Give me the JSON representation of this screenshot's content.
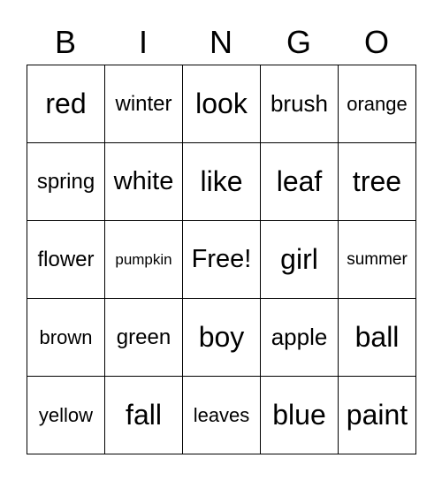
{
  "header": [
    "B",
    "I",
    "N",
    "G",
    "O"
  ],
  "cells": [
    "red",
    "winter",
    "look",
    "brush",
    "orange",
    "spring",
    "white",
    "like",
    "leaf",
    "tree",
    "flower",
    "pumpkin",
    "Free!",
    "girl",
    "summer",
    "brown",
    "green",
    "boy",
    "apple",
    "ball",
    "yellow",
    "fall",
    "leaves",
    "blue",
    "paint"
  ]
}
